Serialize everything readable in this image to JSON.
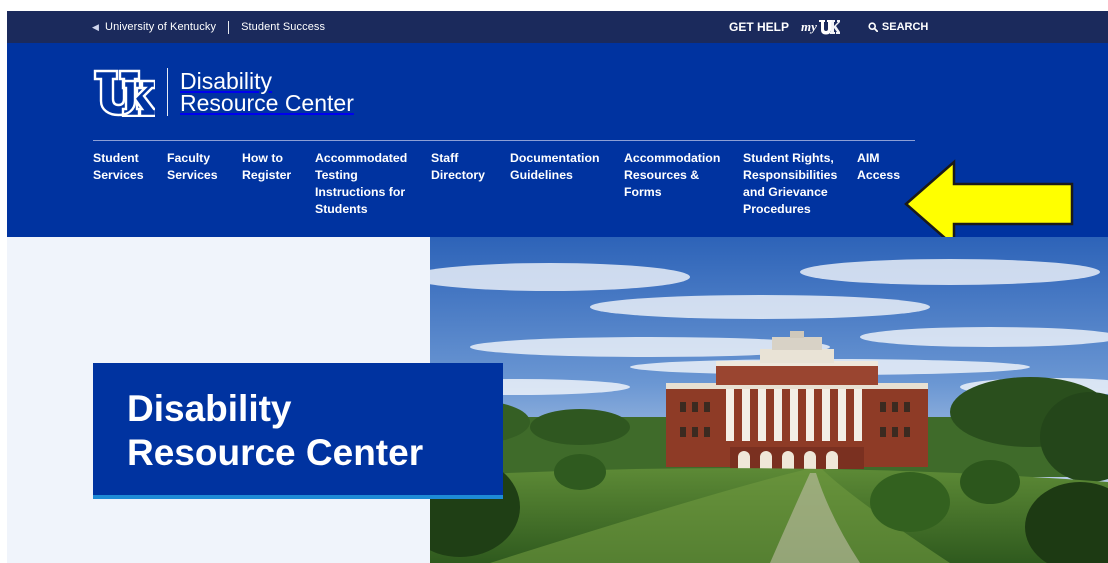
{
  "topbar": {
    "breadcrumb_home": "University of Kentucky",
    "breadcrumb_section": "Student Success",
    "get_help": "GET HELP",
    "my_prefix": "my",
    "search_label": "SEARCH"
  },
  "header": {
    "title_line1": "Disability",
    "title_line2": "Resource Center"
  },
  "nav": [
    {
      "lines": [
        "Student",
        "Services"
      ]
    },
    {
      "lines": [
        "Faculty",
        "Services"
      ]
    },
    {
      "lines": [
        "How to",
        "Register"
      ]
    },
    {
      "lines": [
        "Accommodated",
        "Testing",
        "Instructions for",
        "Students"
      ]
    },
    {
      "lines": [
        "Staff",
        "Directory"
      ]
    },
    {
      "lines": [
        "Documentation",
        "Guidelines"
      ]
    },
    {
      "lines": [
        "Accommodation",
        "Resources &",
        "Forms"
      ]
    },
    {
      "lines": [
        "Student Rights,",
        "Responsibilities",
        "and Grievance",
        "Procedures"
      ]
    },
    {
      "lines": [
        "AIM",
        "Access"
      ]
    }
  ],
  "hero": {
    "title_line1": "Disability",
    "title_line2": "Resource Center"
  },
  "icons": {
    "logo": "uk-logo-icon",
    "search": "search-icon",
    "chevron": "chevron-left-icon",
    "annotation": "arrow-left-icon"
  },
  "colors": {
    "topbar": "#1b2a5c",
    "header": "#0033a0",
    "hero_bg": "#f0f4fb",
    "card_underline": "#1e8bd6",
    "arrow": "#ffff00"
  }
}
